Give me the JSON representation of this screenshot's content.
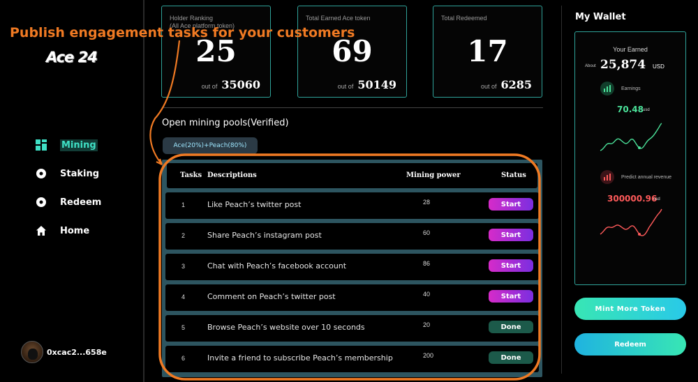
{
  "sidebar": {
    "logo": "Ace 24",
    "nav": [
      {
        "label": "Mining",
        "icon": "grid-icon",
        "active": true
      },
      {
        "label": "Staking",
        "icon": "circle-dot-icon",
        "active": false
      },
      {
        "label": "Redeem",
        "icon": "circle-dot-icon",
        "active": false
      },
      {
        "label": "Home",
        "icon": "home-icon",
        "active": false
      }
    ],
    "user": {
      "address": "0xcac2...658e",
      "avatar": "cat-avatar"
    }
  },
  "stats": [
    {
      "title": "Holder Ranking",
      "subtitle": "(All Ace platform token)",
      "value": "25",
      "of_label": "out of",
      "total": "35060"
    },
    {
      "title": "Total Earned Ace token",
      "subtitle": "",
      "value": "69",
      "of_label": "out of",
      "total": "50149"
    },
    {
      "title": "Total Redeemed",
      "subtitle": "",
      "value": "17",
      "of_label": "out of",
      "total": "6285"
    }
  ],
  "pools": {
    "section_title": "Open mining pools(Verified)",
    "tab_label": "Ace(20%)+Peach(80%)"
  },
  "tasks": {
    "headers": {
      "tasks": "Tasks",
      "descriptions": "Descriptions",
      "mining_power": "Mining power",
      "status": "Status"
    },
    "rows": [
      {
        "num": "1",
        "desc": "Like Peach’s twitter post",
        "power": "28",
        "status": "Start"
      },
      {
        "num": "2",
        "desc": "Share Peach’s instagram post",
        "power": "60",
        "status": "Start"
      },
      {
        "num": "3",
        "desc": "Chat with Peach’s facebook account",
        "power": "86",
        "status": "Start"
      },
      {
        "num": "4",
        "desc": "Comment on Peach’s twitter post",
        "power": "40",
        "status": "Start"
      },
      {
        "num": "5",
        "desc": "Browse Peach’s website over 10 seconds",
        "power": "20",
        "status": "Done"
      },
      {
        "num": "6",
        "desc": "Invite a friend to subscribe Peach’s membership",
        "power": "200",
        "status": "Done"
      }
    ]
  },
  "wallet": {
    "title": "My Wallet",
    "earned_label": "Your Earned",
    "about": "About",
    "amount": "25,874",
    "currency": "USD",
    "earnings_label": "Earnings",
    "earnings_value": "70.48",
    "earnings_unit": "usd",
    "predict_label": "Predict annual revenue",
    "predict_value": "300000.96",
    "predict_unit": "usd"
  },
  "buttons": {
    "mint": "Mint  More Token",
    "redeem": "Redeem"
  },
  "annotation": {
    "text": "Publish engagement tasks for your customers"
  },
  "colors": {
    "accent_teal": "#2fa39a",
    "annotation_orange": "#f07a23",
    "start_magenta": "#d62bc9",
    "done_green": "#1c5a4a",
    "earnings_green": "#4be39a",
    "predict_red": "#ff5a5a"
  }
}
